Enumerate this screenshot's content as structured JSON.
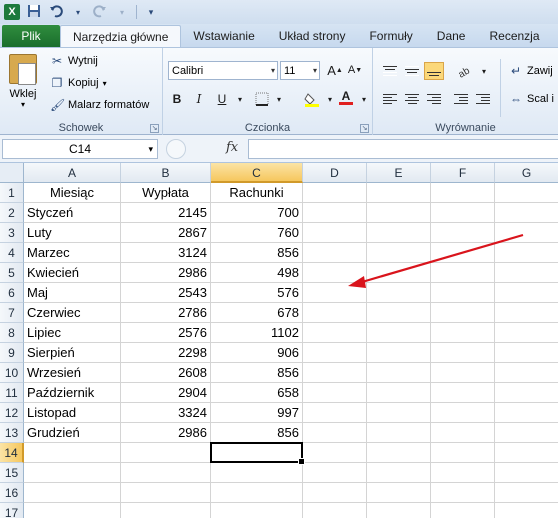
{
  "qat": {
    "app_icon": "X",
    "save_icon": "save-icon",
    "undo_icon": "undo-icon",
    "redo_icon": "redo-icon"
  },
  "tabs": {
    "file": "Plik",
    "items": [
      "Narzędzia główne",
      "Wstawianie",
      "Układ strony",
      "Formuły",
      "Dane",
      "Recenzja"
    ]
  },
  "ribbon": {
    "clipboard": {
      "paste": "Wklej",
      "cut": "Wytnij",
      "copy": "Kopiuj",
      "format_painter": "Malarz formatów",
      "label": "Schowek"
    },
    "font": {
      "name": "Calibri",
      "size": "11",
      "grow": "A",
      "shrink": "A",
      "bold": "B",
      "italic": "I",
      "underline": "U",
      "font_color_letter": "A",
      "label": "Czcionka"
    },
    "alignment": {
      "wrap": "Zawij",
      "merge": "Scal i",
      "label": "Wyrównanie"
    }
  },
  "formula_bar": {
    "name_box": "C14",
    "fx": "fx",
    "value": ""
  },
  "sheet": {
    "columns": [
      "A",
      "B",
      "C",
      "D",
      "E",
      "F",
      "G"
    ],
    "rows": [
      "1",
      "2",
      "3",
      "4",
      "5",
      "6",
      "7",
      "8",
      "9",
      "10",
      "11",
      "12",
      "13",
      "14",
      "15",
      "16",
      "17"
    ],
    "headers": [
      "Miesiąc",
      "Wypłata",
      "Rachunki"
    ],
    "data": [
      [
        "Styczeń",
        "2145",
        "700"
      ],
      [
        "Luty",
        "2867",
        "760"
      ],
      [
        "Marzec",
        "3124",
        "856"
      ],
      [
        "Kwiecień",
        "2986",
        "498"
      ],
      [
        "Maj",
        "2543",
        "576"
      ],
      [
        "Czerwiec",
        "2786",
        "678"
      ],
      [
        "Lipiec",
        "2576",
        "1102"
      ],
      [
        "Sierpień",
        "2298",
        "906"
      ],
      [
        "Wrzesień",
        "2608",
        "856"
      ],
      [
        "Październik",
        "2904",
        "658"
      ],
      [
        "Listopad",
        "3324",
        "997"
      ],
      [
        "Grudzień",
        "2986",
        "856"
      ]
    ],
    "active_cell": "C14"
  },
  "annotation": {
    "arrow_color": "#d9141c"
  }
}
